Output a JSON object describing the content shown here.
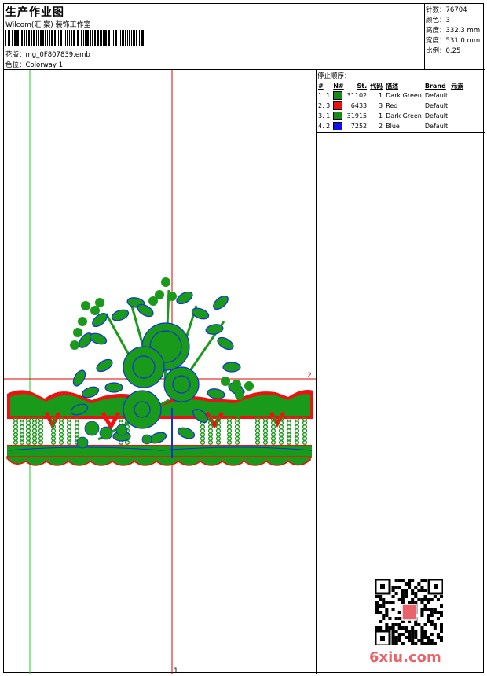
{
  "header": {
    "title": "生产作业图",
    "studio": "Wilcom(汇 案) 装饰工作室",
    "design_file": "花版：mg_0F807839.emb",
    "colorway": "色位：Colorway 1"
  },
  "meta": {
    "stitches": "针数：76704",
    "colors": "颜色：3",
    "height": "高度：332.3 mm",
    "width": "宽度：531.0 mm",
    "scale": "比例：0.25"
  },
  "stop_sequence": {
    "title": "停止顺序：",
    "headers": [
      "#",
      "N#",
      "St.",
      "代码",
      "描述",
      "Brand",
      "元素"
    ],
    "rows": [
      {
        "index": "1. 1",
        "color": "#1a8a1a",
        "stitches": "31102",
        "code": "1",
        "description": "Dark Green",
        "brand": "Default"
      },
      {
        "index": "2. 3",
        "color": "#ee1111",
        "stitches": "6433",
        "code": "3",
        "description": "Red",
        "brand": "Default"
      },
      {
        "index": "3. 1",
        "color": "#1a8a1a",
        "stitches": "31915",
        "code": "1",
        "description": "Dark Green",
        "brand": "Default"
      },
      {
        "index": "4. 2",
        "color": "#1010ee",
        "stitches": "7252",
        "code": "2",
        "description": "Blue",
        "brand": "Default"
      }
    ]
  },
  "canvas": {
    "guide_label_right": "2",
    "guide_label_bottom": "1"
  },
  "watermark": {
    "logo_text": "6xiu.com"
  },
  "colors": {
    "green": "#1a9a1a",
    "red": "#ee1111",
    "blue": "#1030e0",
    "guide_red": "#dd0000",
    "guide_green": "#22cc22"
  }
}
